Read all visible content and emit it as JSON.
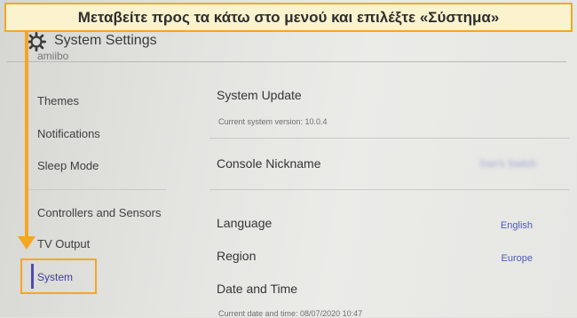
{
  "header": {
    "title": "System Settings",
    "icon": "gear-icon"
  },
  "sidebar": {
    "cut_item": "amiibo",
    "items": [
      {
        "label": "Themes"
      },
      {
        "label": "Notifications"
      },
      {
        "label": "Sleep Mode"
      },
      {
        "label": "Controllers and Sensors"
      },
      {
        "label": "TV Output"
      },
      {
        "label": "System"
      }
    ],
    "selected": "System"
  },
  "main": {
    "system_update": {
      "title": "System Update",
      "sub": "Current system version: 10.0.4"
    },
    "console_nickname": {
      "title": "Console Nickname",
      "value": "Dan's Switch"
    },
    "language": {
      "title": "Language",
      "value": "English"
    },
    "region": {
      "title": "Region",
      "value": "Europe"
    },
    "date_time": {
      "title": "Date and Time",
      "sub": "Current date and time: 08/07/2020 10:47"
    }
  },
  "annotation": {
    "banner": "Μεταβείτε προς τα κάτω στο μενού και επιλέξτε «Σύστημα»",
    "color": "#f5a623"
  }
}
